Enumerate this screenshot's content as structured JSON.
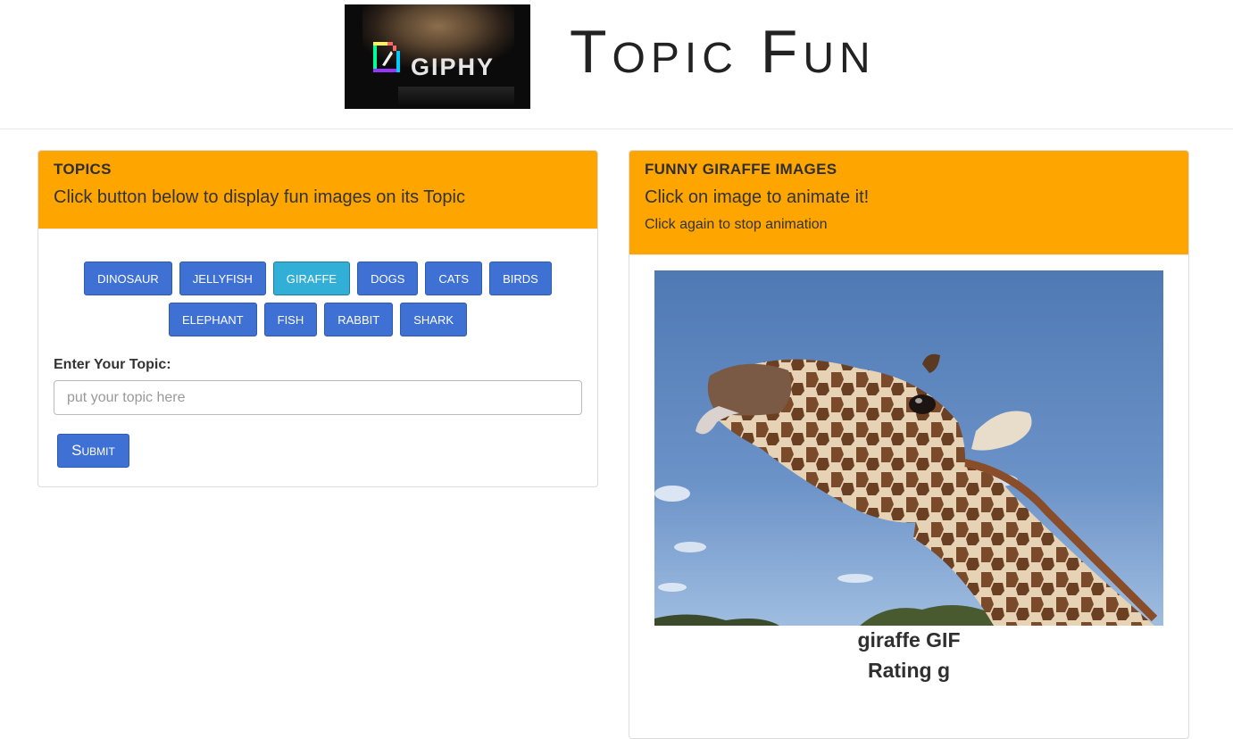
{
  "header": {
    "logo_text": "GIPHY",
    "title": "Topic Fun"
  },
  "topics_panel": {
    "title": "TOPICS",
    "subtitle": "Click button below to display fun images on its Topic",
    "buttons_row1": [
      "DINOSAUR",
      "JELLYFISH",
      "GIRAFFE",
      "DOGS",
      "CATS",
      "BIRDS"
    ],
    "buttons_row2": [
      "ELEPHANT",
      "FISH",
      "RABBIT",
      "SHARK"
    ],
    "active_button": "GIRAFFE",
    "form_label": "Enter Your Topic:",
    "input_placeholder": "put your topic here",
    "input_value": "",
    "submit_label": "Submit"
  },
  "images_panel": {
    "title": "FUNNY GIRAFFE IMAGES",
    "subtitle": "Click on image to animate it!",
    "note": "Click again to stop animation",
    "image_title": "giraffe GIF",
    "image_rating": "Rating g"
  },
  "colors": {
    "panel_heading": "#ffa500",
    "button": "#3f70d3",
    "button_active": "#31afd6"
  },
  "icons": [
    "giphy-logo-icon"
  ]
}
